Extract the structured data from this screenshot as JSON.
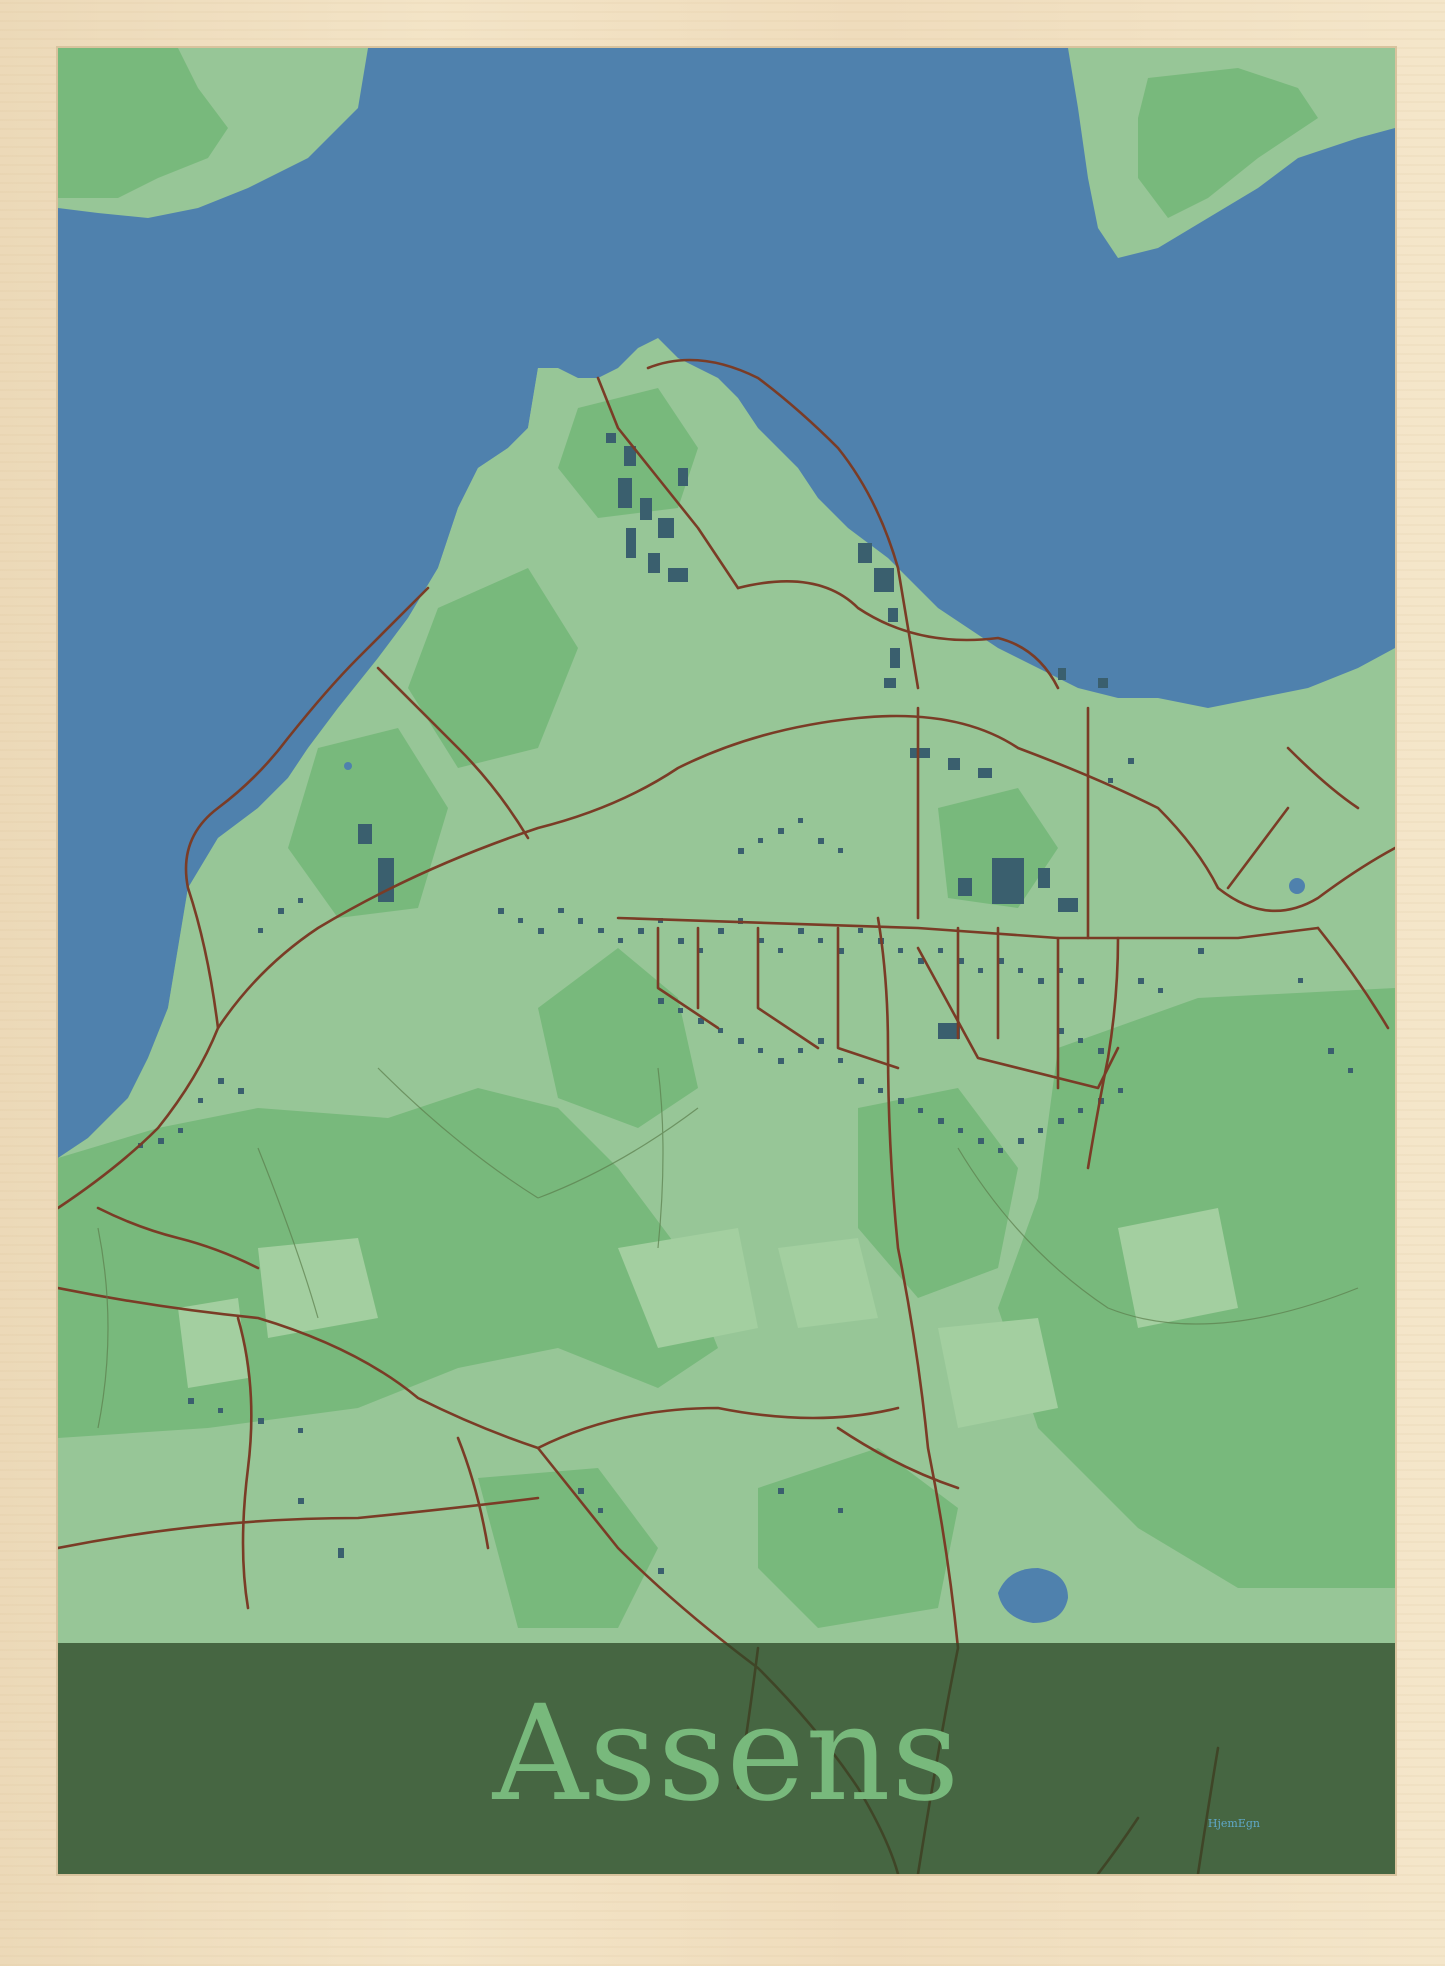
{
  "poster": {
    "city_name": "Assens",
    "brand": "HjemEgn",
    "colors": {
      "water": "#4f81ad",
      "land_light": "#97c697",
      "land_mid": "#78b97c",
      "roads": "#7a3c26",
      "buildings": "#3a5f6e",
      "title_band": "#2d4828",
      "title_text": "#78b97c",
      "frame": "#f0dfc0"
    }
  }
}
